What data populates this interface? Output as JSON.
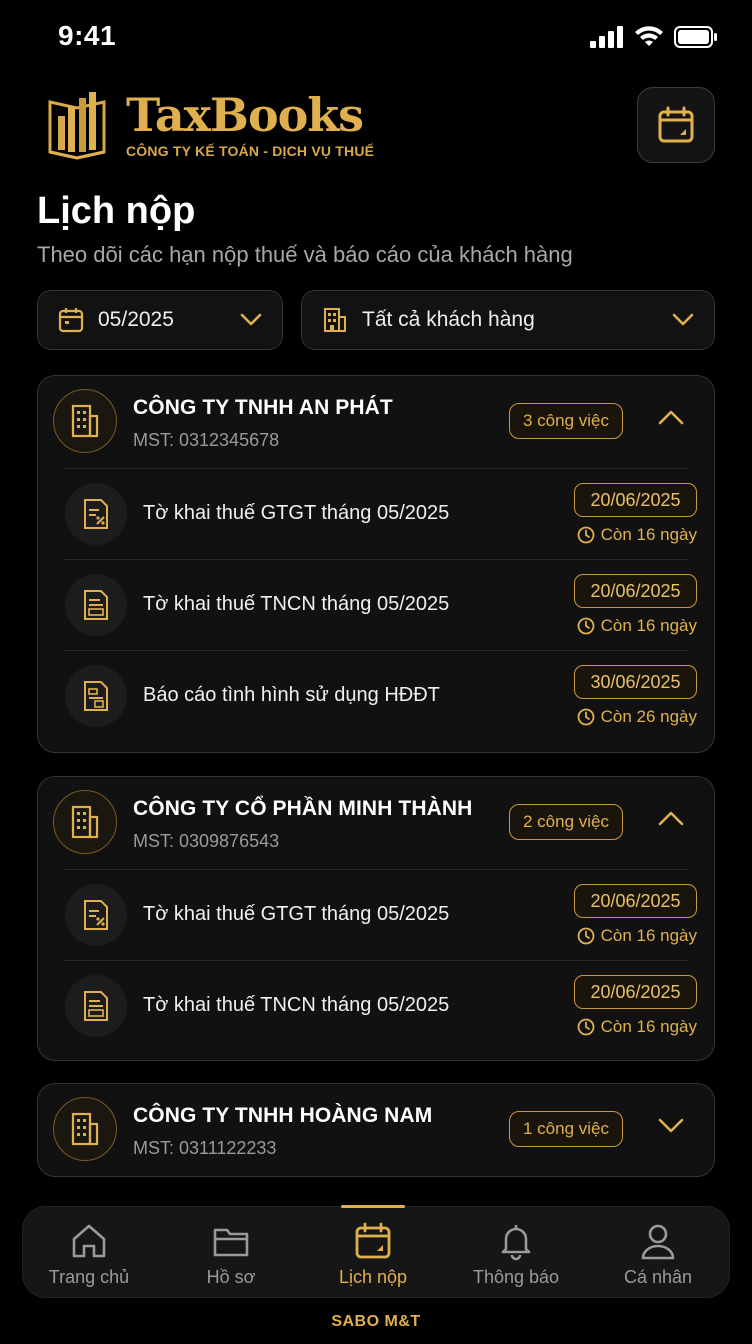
{
  "status": {
    "time": "9:41"
  },
  "header": {
    "brand": "TaxBooks",
    "brand_sub": "CÔNG TY KẾ TOÁN - DỊCH VỤ THUẾ"
  },
  "page": {
    "title": "Lịch nộp",
    "subtitle": "Theo dõi các hạn nộp thuế và báo cáo của khách hàng"
  },
  "filters": {
    "month": "05/2025",
    "client": "Tất cả khách hàng"
  },
  "companies": [
    {
      "name": "CÔNG TY TNHH AN PHÁT",
      "tax_id": "MST: 0312345678",
      "task_count": "3 công việc",
      "expanded": true,
      "tasks": [
        {
          "name": "Tờ khai thuế GTGT tháng 05/2025",
          "date": "20/06/2025",
          "remaining": "Còn 16 ngày",
          "icon": "vat-document-icon"
        },
        {
          "name": "Tờ khai thuế TNCN tháng 05/2025",
          "date": "20/06/2025",
          "remaining": "Còn 16 ngày",
          "icon": "pit-document-icon"
        },
        {
          "name": "Báo cáo tình hình sử dụng HĐĐT",
          "date": "30/06/2025",
          "remaining": "Còn 26 ngày",
          "icon": "invoice-report-icon"
        }
      ]
    },
    {
      "name": "CÔNG TY CỔ PHẦN MINH THÀNH",
      "tax_id": "MST: 0309876543",
      "task_count": "2 công việc",
      "expanded": true,
      "tasks": [
        {
          "name": "Tờ khai thuế GTGT tháng 05/2025",
          "date": "20/06/2025",
          "remaining": "Còn 16 ngày",
          "icon": "vat-document-icon"
        },
        {
          "name": "Tờ khai thuế TNCN tháng 05/2025",
          "date": "20/06/2025",
          "remaining": "Còn 16 ngày",
          "icon": "pit-document-icon"
        }
      ]
    },
    {
      "name": "CÔNG TY TNHH HOÀNG NAM",
      "tax_id": "MST: 0311122233",
      "task_count": "1 công việc",
      "expanded": false,
      "tasks": []
    }
  ],
  "nav": {
    "items": [
      {
        "label": "Trang chủ",
        "icon": "home-icon"
      },
      {
        "label": "Hồ sơ",
        "icon": "folder-icon"
      },
      {
        "label": "Lịch nộp",
        "icon": "calendar-icon",
        "active": true
      },
      {
        "label": "Thông báo",
        "icon": "bell-icon"
      },
      {
        "label": "Cá nhân",
        "icon": "user-icon"
      }
    ]
  },
  "footer": {
    "brand": "SABO M&T"
  },
  "colors": {
    "accent": "#e0b04f",
    "background": "#000000",
    "card": "#111111"
  }
}
